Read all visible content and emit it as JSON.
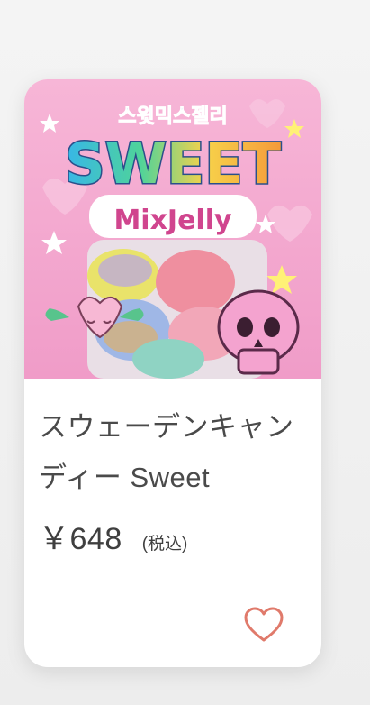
{
  "product": {
    "image_title_korean": "스윗믹스젤리",
    "image_word_sweet": "SWEET",
    "image_word_mixjelly": "MixJelly",
    "name_line1": "スウェーデンキャン",
    "name_line2": "ディー Sweet",
    "price": "￥648",
    "tax_label": "(税込)"
  },
  "icons": {
    "favorite": "heart-outline-icon"
  },
  "colors": {
    "package_pink": "#f3a9cf",
    "heart_accent": "#e07a6b",
    "text_dark": "#4a4a4a"
  }
}
